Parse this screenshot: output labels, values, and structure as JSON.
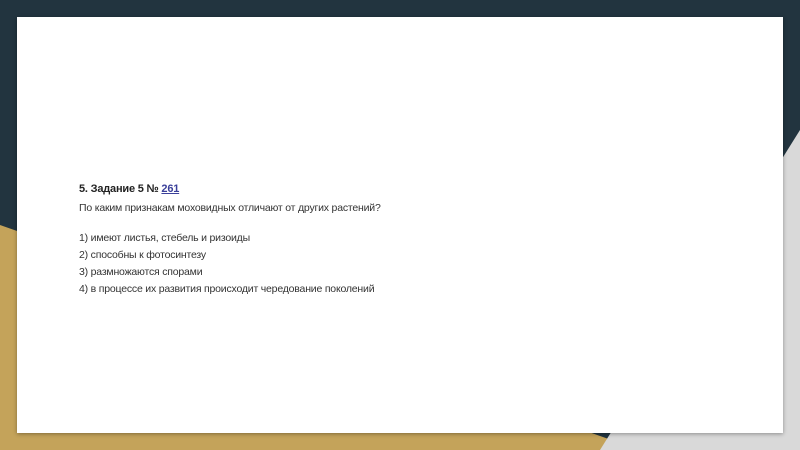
{
  "colors": {
    "navy": "#22343f",
    "gold": "#c4a35a",
    "gray": "#d9d9d9"
  },
  "task": {
    "title": "5. Задание 5 №",
    "number_link": "261",
    "question": "По каким признакам моховидных отличают от других растений?",
    "options": [
      "1) имеют листья, стебель и ризоиды",
      "2) способны к фотосинтезу",
      "3) размножаются спорами",
      "4) в процессе их развития происходит чередование поколений"
    ]
  }
}
